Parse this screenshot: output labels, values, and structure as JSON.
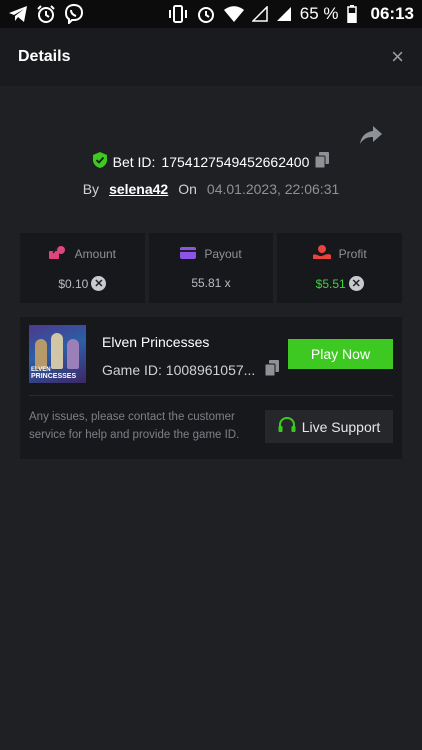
{
  "status_bar": {
    "battery": "65 %",
    "time": "06:13"
  },
  "header": {
    "title": "Details",
    "close_label": "×"
  },
  "bet": {
    "id_label": "Bet ID:",
    "id_value": "1754127549452662400",
    "by_label": "By",
    "username": "selena42",
    "on_label": "On",
    "datetime": "04.01.2023, 22:06:31"
  },
  "stats": {
    "amount": {
      "label": "Amount",
      "value": "$0.10"
    },
    "payout": {
      "label": "Payout",
      "value": "55.81 x"
    },
    "profit": {
      "label": "Profit",
      "value": "$5.51"
    }
  },
  "game": {
    "name": "Elven Princesses",
    "id_text": "Game ID: 1008961057...",
    "thumb_line1": "ELVEN",
    "thumb_line2": "PRINCESSES",
    "play_label": "Play Now",
    "note": "Any issues, please contact the customer service for help and provide the game ID.",
    "support_label": "Live Support"
  },
  "colors": {
    "accent": "#3ec922",
    "background": "#1f2023",
    "card": "#17181b"
  }
}
